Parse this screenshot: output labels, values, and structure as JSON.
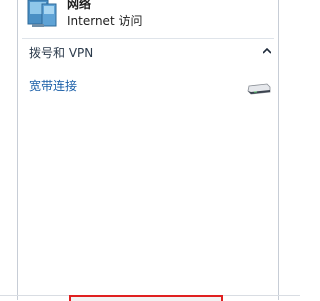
{
  "network": {
    "title": "网络",
    "status": "Internet 访问"
  },
  "dialup_section": {
    "title": "拨号和 VPN",
    "expanded": true,
    "items": [
      {
        "label": "宽带连接",
        "icon": "modem-icon"
      }
    ]
  },
  "icons": {
    "network": "network-computer-icon",
    "chevron": "chevron-up-icon",
    "connection": "modem-icon"
  },
  "colors": {
    "link": "#1b5fa8",
    "highlight": "#e02020",
    "border": "#c7cdd6"
  }
}
